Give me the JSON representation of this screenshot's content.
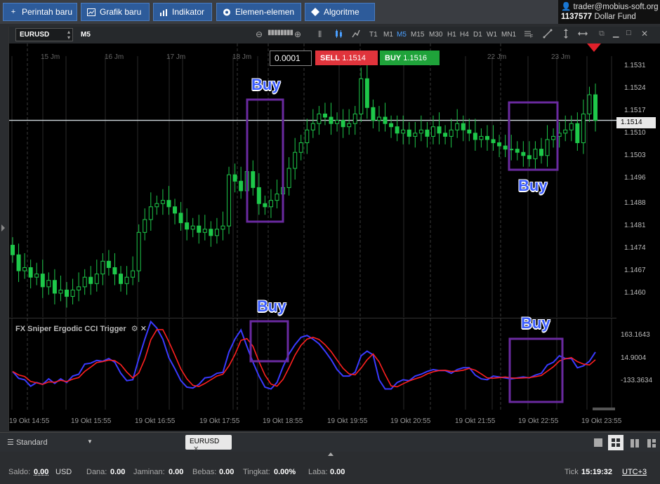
{
  "toolbar": {
    "new_order": "Perintah baru",
    "new_chart": "Grafik baru",
    "indicator": "Indikator",
    "elements": "Elemen-elemen",
    "algorithm": "Algoritme"
  },
  "account": {
    "user": "trader@mobius-soft.org",
    "fund_id": "1137577",
    "fund_name": "Dollar Fund"
  },
  "chart_toolbar": {
    "symbol": "EURUSD",
    "timeframe": "M5",
    "timeframes": [
      "T1",
      "M1",
      "M5",
      "M15",
      "M30",
      "H1",
      "H4",
      "D1",
      "W1",
      "MN1"
    ],
    "active_timeframe": "M5"
  },
  "trade_panel": {
    "quantity": "0.0001",
    "sell_label": "SELL",
    "sell_price": "1.1514",
    "buy_label": "BUY",
    "buy_price": "1.1516"
  },
  "chart_data": {
    "type": "candlestick",
    "symbol": "EURUSD",
    "price_ticks": [
      "1.1531",
      "1.1524",
      "1.1517",
      "1.1510",
      "1.1503",
      "1.1496",
      "1.1488",
      "1.1481",
      "1.1474",
      "1.1467",
      "1.1460"
    ],
    "current_price": "1.1514",
    "top_time_labels": [
      "15 Jm",
      "16 Jm",
      "17 Jm",
      "18 Jm",
      "22 Jm",
      "23 Jm"
    ],
    "bottom_time_labels": [
      "19 Okt 14:55",
      "19 Okt 15:55",
      "19 Okt 16:55",
      "19 Okt 17:55",
      "19 Okt 18:55",
      "19 Okt 19:55",
      "19 Okt 20:55",
      "19 Okt 21:55",
      "19 Okt 22:55",
      "19 Okt 23:55"
    ],
    "closes": [
      1.1472,
      1.1467,
      1.1468,
      1.1465,
      1.1466,
      1.1462,
      1.1464,
      1.146,
      1.1461,
      1.1459,
      1.1461,
      1.1462,
      1.1465,
      1.1463,
      1.1466,
      1.147,
      1.1468,
      1.1466,
      1.1463,
      1.1465,
      1.1467,
      1.1479,
      1.1483,
      1.1487,
      1.1488,
      1.1489,
      1.1487,
      1.1485,
      1.1482,
      1.148,
      1.1481,
      1.1479,
      1.148,
      1.1478,
      1.148,
      1.1481,
      1.1497,
      1.1495,
      1.1492,
      1.1498,
      1.1493,
      1.1488,
      1.1487,
      1.1489,
      1.1491,
      1.1493,
      1.1499,
      1.1504,
      1.1507,
      1.1511,
      1.1513,
      1.1516,
      1.1515,
      1.1513,
      1.1514,
      1.1512,
      1.1513,
      1.1516,
      1.1527,
      1.1518,
      1.1514,
      1.1515,
      1.1513,
      1.1512,
      1.151,
      1.1511,
      1.1509,
      1.151,
      1.1511,
      1.1509,
      1.1512,
      1.151,
      1.1509,
      1.1511,
      1.1513,
      1.1511,
      1.151,
      1.1508,
      1.1509,
      1.1508,
      1.1507,
      1.1506,
      1.1505,
      1.1505,
      1.1504,
      1.1503,
      1.1502,
      1.1505,
      1.1503,
      1.1508,
      1.1509,
      1.151,
      1.1511,
      1.1513,
      1.1507,
      1.1516,
      1.1522,
      1.1514
    ],
    "indicator": {
      "name": "FX Sniper Ergodic CCI Trigger",
      "ticks": [
        "163.1643",
        "14.9004",
        "-133.3634"
      ],
      "series": [
        {
          "name": "Ergodic",
          "color": "#3a3aff"
        },
        {
          "name": "Trigger",
          "color": "#ff2020"
        }
      ]
    },
    "annotations": [
      "Buy",
      "Buy",
      "Buy",
      "Buy"
    ]
  },
  "bottom": {
    "layout_select": "Standard",
    "tab": "EURUSD"
  },
  "status": {
    "saldo_label": "Saldo:",
    "saldo_value": "0.00",
    "saldo_currency": "USD",
    "dana_label": "Dana:",
    "dana_value": "0.00",
    "jaminan_label": "Jaminan:",
    "jaminan_value": "0.00",
    "bebas_label": "Bebas:",
    "bebas_value": "0.00",
    "tingkat_label": "Tingkat:",
    "tingkat_value": "0.00%",
    "laba_label": "Laba:",
    "laba_value": "0.00",
    "tick_label": "Tick",
    "time": "15:19:32",
    "timezone": "UTC+3"
  }
}
